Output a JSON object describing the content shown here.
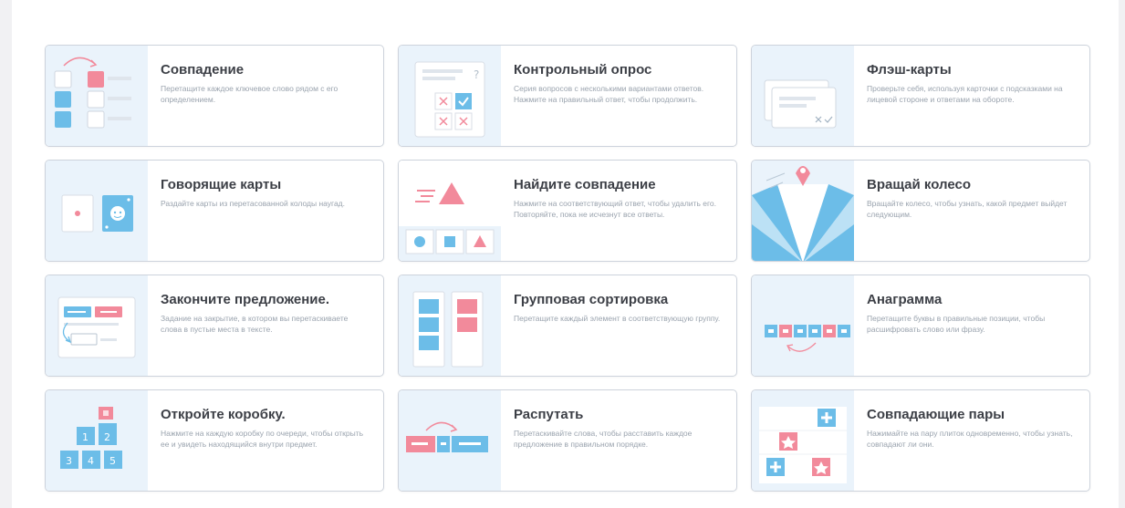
{
  "templates": [
    {
      "id": "match",
      "icon": "match-up-icon",
      "title": "Совпадение",
      "desc": "Перетащите каждое ключевое слово рядом с его определением."
    },
    {
      "id": "quiz",
      "icon": "quiz-icon",
      "title": "Контрольный опрос",
      "desc": "Серия вопросов с несколькими вариантами ответов. Нажмите на правильный ответ, чтобы продолжить."
    },
    {
      "id": "flashcards",
      "icon": "flash-cards-icon",
      "title": "Флэш-карты",
      "desc": "Проверьте себя, используя карточки с подсказками на лицевой стороне и ответами на обороте."
    },
    {
      "id": "speaking",
      "icon": "speaking-cards-icon",
      "title": "Говорящие карты",
      "desc": "Раздайте карты из перетасованной колоды наугад."
    },
    {
      "id": "find-match",
      "icon": "find-the-match-icon",
      "title": "Найдите совпадение",
      "desc": "Нажмите на соответствующий ответ, чтобы удалить его. Повторяйте, пока не исчезнут все ответы."
    },
    {
      "id": "wheel",
      "icon": "spin-wheel-icon",
      "title": "Вращай колесо",
      "desc": "Вращайте колесо, чтобы узнать, какой предмет выйдет следующим."
    },
    {
      "id": "complete",
      "icon": "complete-sentence-icon",
      "title": "Закончите предложение.",
      "desc": "Задание на закрытие, в котором вы перетаскиваете слова в пустые места в тексте."
    },
    {
      "id": "group-sort",
      "icon": "group-sort-icon",
      "title": "Групповая сортировка",
      "desc": "Перетащите каждый элемент в соответствующую группу."
    },
    {
      "id": "anagram",
      "icon": "anagram-icon",
      "title": "Анаграмма",
      "desc": "Перетащите буквы в правильные позиции, чтобы расшифровать слово или фразу."
    },
    {
      "id": "open-box",
      "icon": "open-the-box-icon",
      "title": "Откройте коробку.",
      "desc": "Нажмите на каждую коробку по очереди, чтобы открыть ее и увидеть находящийся внутри предмет."
    },
    {
      "id": "unjumble",
      "icon": "unjumble-icon",
      "title": "Распутать",
      "desc": "Перетаскивайте слова, чтобы расставить каждое предложение в правильном порядке."
    },
    {
      "id": "matching-pairs",
      "icon": "matching-pairs-icon",
      "title": "Совпадающие пары",
      "desc": "Нажимайте на пару плиток одновременно, чтобы узнать, совпадают ли они."
    }
  ],
  "colors": {
    "pink": "#f28a9b",
    "blue": "#6cbde8",
    "thumb_bg": "#eaf3fb",
    "title": "#3c3f46",
    "desc": "#9aa3ae",
    "border": "#cdd3dc"
  }
}
